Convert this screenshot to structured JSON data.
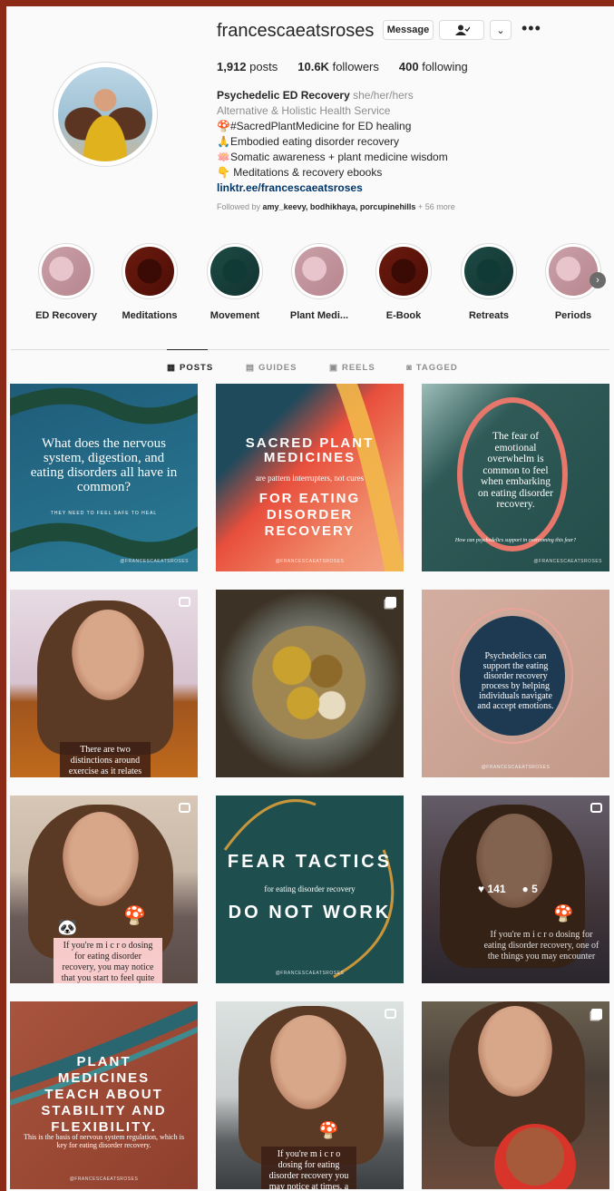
{
  "profile": {
    "username": "francescaeatsroses",
    "message_label": "Message",
    "stats": {
      "posts": "1,912",
      "posts_label": "posts",
      "followers": "10.6K",
      "followers_label": "followers",
      "following": "400",
      "following_label": "following"
    },
    "bio": {
      "name": "Psychedelic ED Recovery",
      "pronouns": "she/her/hers",
      "category": "Alternative & Holistic Health Service",
      "lines": [
        "🍄#SacredPlantMedicine for ED healing",
        "🙏Embodied eating disorder recovery",
        "🪷Somatic awareness + plant medicine wisdom",
        "👇 Meditations & recovery ebooks"
      ],
      "link": "linktr.ee/francescaeatsroses"
    },
    "followed_by_prefix": "Followed by",
    "followed_by_names": "amy_keevy, bodhikhaya, porcupinehills",
    "followed_by_more": "+ 56 more"
  },
  "highlights": [
    {
      "label": "ED Recovery",
      "style": "pink"
    },
    {
      "label": "Meditations",
      "style": "maroon"
    },
    {
      "label": "Movement",
      "style": "teal"
    },
    {
      "label": "Plant Medi...",
      "style": "pink"
    },
    {
      "label": "E-Book",
      "style": "maroon"
    },
    {
      "label": "Retreats",
      "style": "teal"
    },
    {
      "label": "Periods",
      "style": "pink"
    }
  ],
  "tabs": [
    {
      "label": "POSTS",
      "icon": "grid-icon"
    },
    {
      "label": "GUIDES",
      "icon": "guides-icon"
    },
    {
      "label": "REELS",
      "icon": "reels-icon"
    },
    {
      "label": "TAGGED",
      "icon": "tagged-icon"
    }
  ],
  "posts": {
    "p1": {
      "text": "What does the nervous system, digestion, and eating disorders all have in common?",
      "sub": "THEY NEED TO FEEL SAFE TO HEAL",
      "wm": "@FRANCESCAEATSROSES"
    },
    "p2": {
      "t1": "SACRED PLANT MEDICINES",
      "t2": "are pattern interrupters, not cures",
      "t3": "FOR EATING DISORDER RECOVERY",
      "wm": "@FRANCESCAEATSROSES"
    },
    "p3": {
      "text": "The fear of emotional overwhelm is common to feel when embarking on eating disorder recovery.",
      "arc": "How can psychedelics support in overcoming this fear?",
      "wm": "@FRANCESCAEATSROSES"
    },
    "p4": {
      "caption": "There are two distinctions around exercise as it relates to eating disorders"
    },
    "p6": {
      "text": "Psychedelics can support the eating disorder recovery process by helping individuals navigate and accept emotions.",
      "wm": "@FRANCESCAEATSROSES"
    },
    "p7": {
      "caption": "If you're m i c r o dosing for eating disorder recovery, you may notice that you start to feel quite tired"
    },
    "p8": {
      "t1": "FEAR TACTICS",
      "t2": "for eating disorder recovery",
      "t3": "DO NOT WORK",
      "wm": "@FRANCESCAEATSROSES"
    },
    "p9": {
      "likes": "141",
      "comments": "5",
      "caption": "If you're m i c r o dosing for eating disorder recovery, one of the things you may encounter"
    },
    "p10": {
      "t1": "PLANT MEDICINES TEACH ABOUT STABILITY AND FLEXIBILITY.",
      "t2": "This is the basis of nervous system regulation, which is key for eating disorder recovery.",
      "wm": "@FRANCESCAEATSROSES"
    },
    "p11": {
      "caption": "If you're m i c r o dosing for eating disorder recovery you may notice at times, a feeling of being a bit lost"
    }
  }
}
